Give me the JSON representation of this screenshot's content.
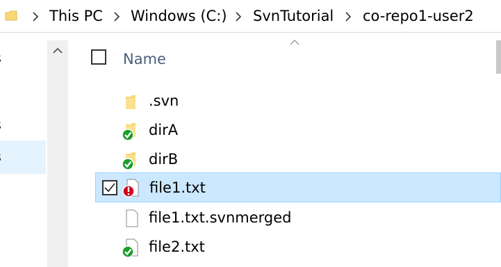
{
  "breadcrumb": {
    "items": [
      "This PC",
      "Windows (C:)",
      "SvnTutorial",
      "co-repo1-user2"
    ]
  },
  "nav": {
    "items": [
      "s",
      "s",
      "s"
    ]
  },
  "list": {
    "header_name": "Name",
    "files": [
      {
        "name": ".svn",
        "icon": "folder-icon",
        "status": "none"
      },
      {
        "name": "dirA",
        "icon": "folder-icon",
        "status": "normal"
      },
      {
        "name": "dirB",
        "icon": "folder-icon",
        "status": "normal"
      },
      {
        "name": "file1.txt",
        "icon": "file-icon",
        "status": "conflicted",
        "selected": true,
        "checked": true
      },
      {
        "name": "file1.txt.svnmerged",
        "icon": "file-icon",
        "status": "none"
      },
      {
        "name": "file2.txt",
        "icon": "file-icon",
        "status": "normal"
      }
    ]
  },
  "colors": {
    "selection": "#cce8ff",
    "nav_selection": "#e5f3ff",
    "ok_overlay": "#1a9e2a",
    "conflict_overlay": "#d0021b"
  }
}
